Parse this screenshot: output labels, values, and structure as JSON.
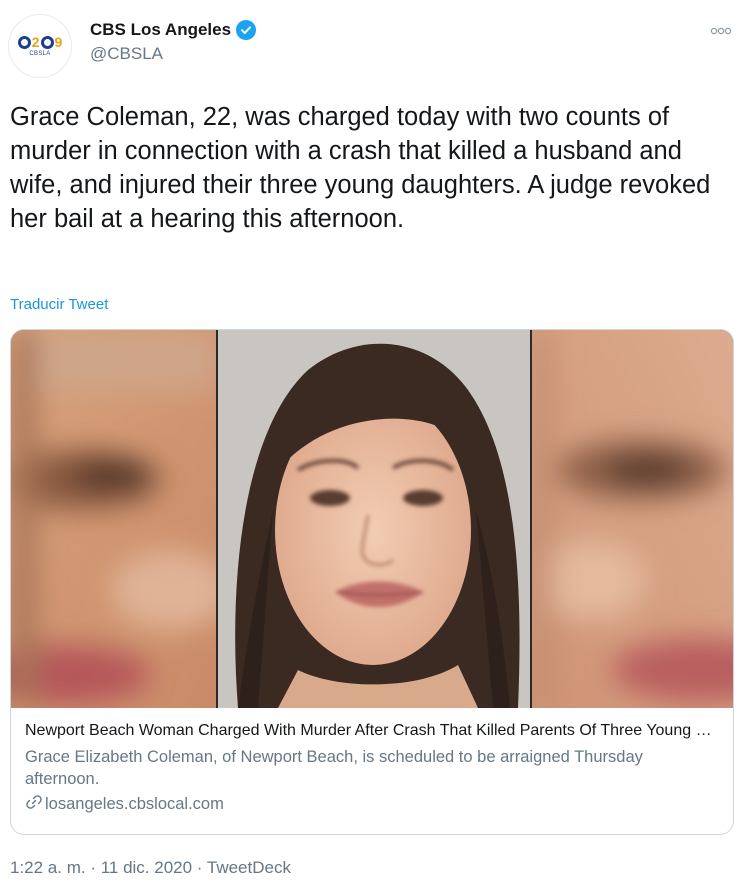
{
  "account": {
    "display_name": "CBS Los Angeles",
    "handle": "@CBSLA",
    "avatar_number": "2",
    "avatar_number_b": "9",
    "avatar_sub": "CBSLA"
  },
  "icons": {
    "verified": "verified-badge-icon",
    "more": "more-options-icon",
    "link": "link-icon"
  },
  "tweet": {
    "text": "Grace Coleman, 22, was charged today with two counts of murder in connection with a crash that killed a husband and wife, and injured their three young daughters. A judge revoked her bail at a hearing this afternoon.",
    "translate_label": "Traducir Tweet"
  },
  "card": {
    "title": "Newport Beach Woman Charged With Murder After Crash That Killed Parents Of Three Young Daughters",
    "description": "Grace Elizabeth Coleman, of Newport Beach, is scheduled to be arraigned Thursday afternoon.",
    "domain": "losangeles.cbslocal.com"
  },
  "meta": {
    "timestamp": "1:22 a. m. · 11 dic. 2020 · TweetDeck"
  },
  "colors": {
    "accent": "#1da1f2",
    "link": "#1b95e0",
    "secondary_text": "#657786",
    "border": "#ccd6dd"
  }
}
